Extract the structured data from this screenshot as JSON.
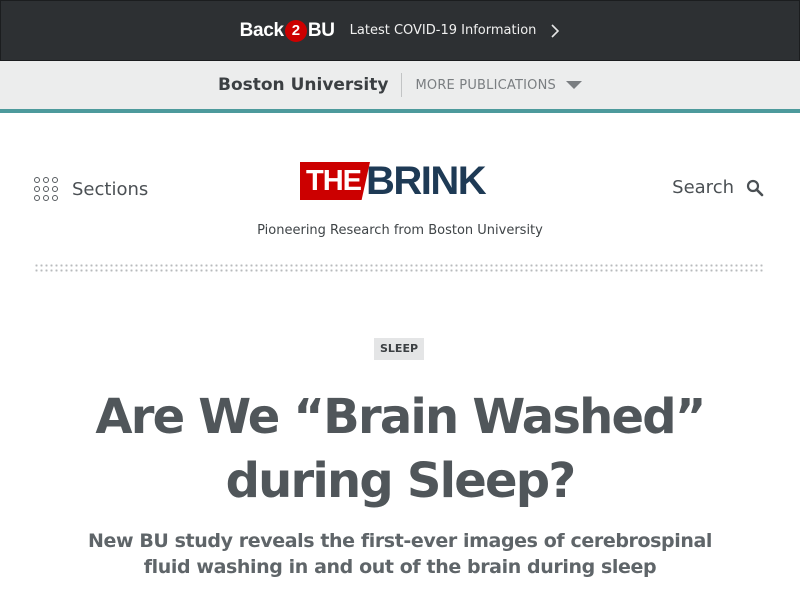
{
  "banner": {
    "logo_left": "Back",
    "logo_number": "2",
    "logo_right": "BU",
    "text": "Latest COVID-19 Information",
    "chevron_icon": "chevron-right-icon"
  },
  "bu_bar": {
    "title": "Boston University",
    "more_label": "MORE PUBLICATIONS",
    "caret_icon": "caret-down-icon"
  },
  "header": {
    "sections_label": "Sections",
    "sections_icon": "grid-dots-icon",
    "logo_the": "THE",
    "logo_brink": "BRINK",
    "tagline": "Pioneering Research from Boston University",
    "search_label": "Search",
    "search_icon": "magnifier-icon"
  },
  "article": {
    "tag": "SLEEP",
    "headline": "Are We “Brain Washed” during Sleep?",
    "deck": "New BU study reveals the first-ever images of cerebrospinal fluid washing in and out of the brain during sleep"
  },
  "colors": {
    "banner_bg": "#2d3033",
    "bu_red": "#cc0000",
    "brink_navy": "#1e3a55",
    "teal_rule": "#4d9a9c",
    "bu_bar_bg": "#eceded"
  }
}
